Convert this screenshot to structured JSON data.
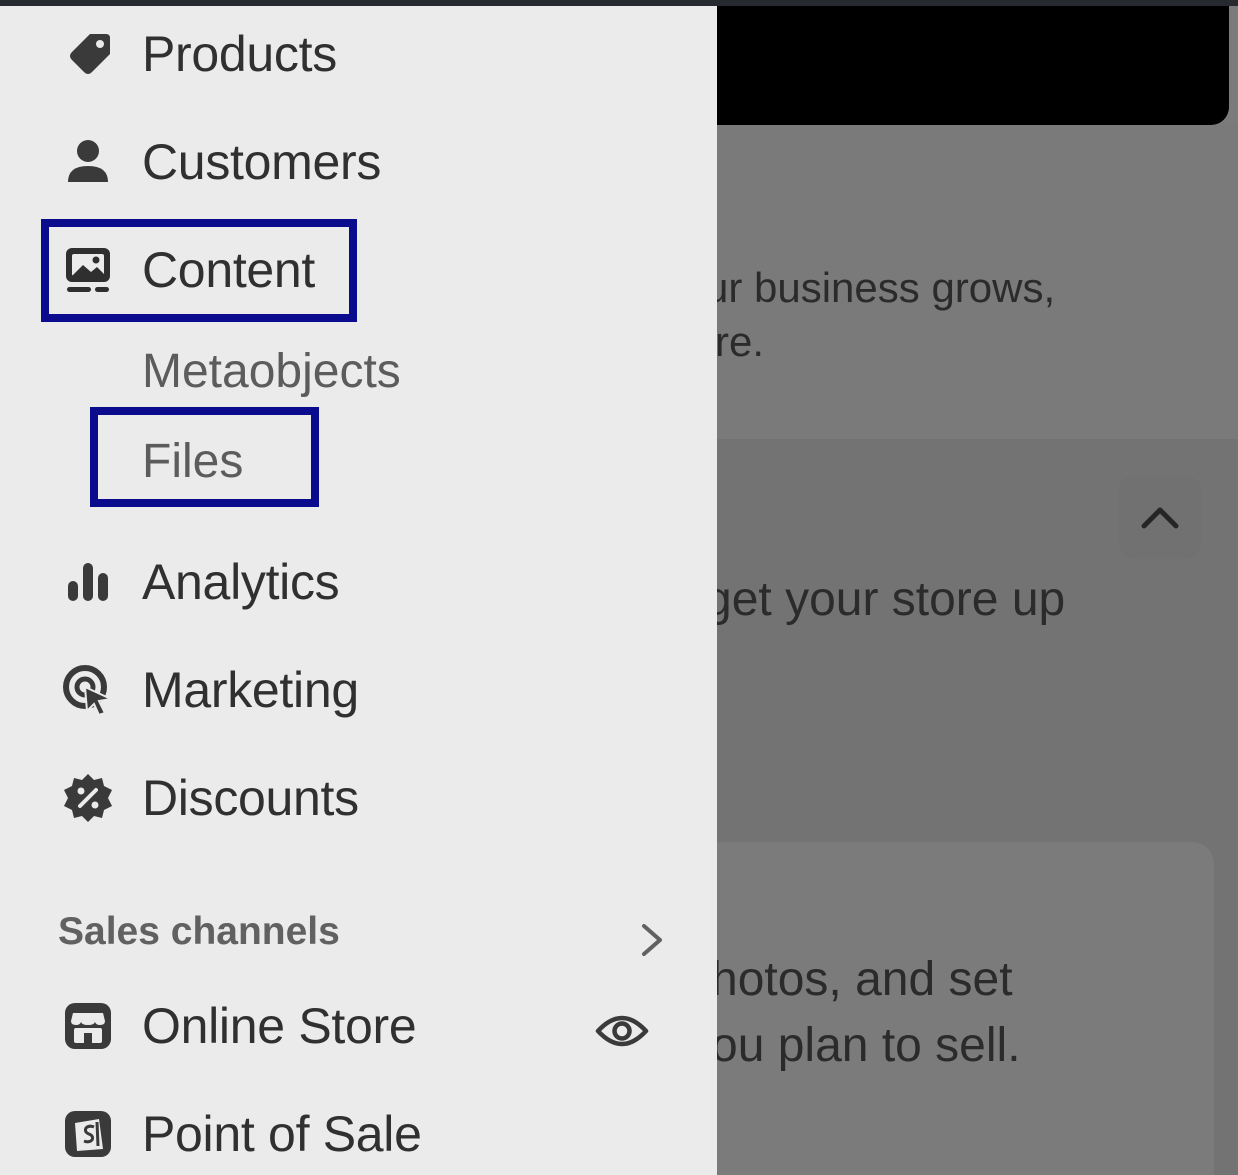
{
  "nav": {
    "products": "Products",
    "customers": "Customers",
    "content": "Content",
    "content_sub": [
      "Metaobjects",
      "Files"
    ],
    "analytics": "Analytics",
    "marketing": "Marketing",
    "discounts": "Discounts"
  },
  "sales_channels": {
    "title": "Sales channels",
    "items": [
      "Online Store",
      "Point of Sale"
    ]
  },
  "background": {
    "line1": "ur business grows,",
    "line2": "re.",
    "line3": "get your store up",
    "line4": "hotos, and set",
    "line5": "ou plan to sell."
  },
  "highlight_color": "#0b0b8e",
  "icons": [
    "tag-icon",
    "person-icon",
    "content-icon",
    "bar-chart-icon",
    "target-cursor-icon",
    "discount-badge-icon",
    "chevron-right-icon",
    "store-icon",
    "eye-icon",
    "shopping-bag-icon",
    "chevron-up-icon"
  ]
}
